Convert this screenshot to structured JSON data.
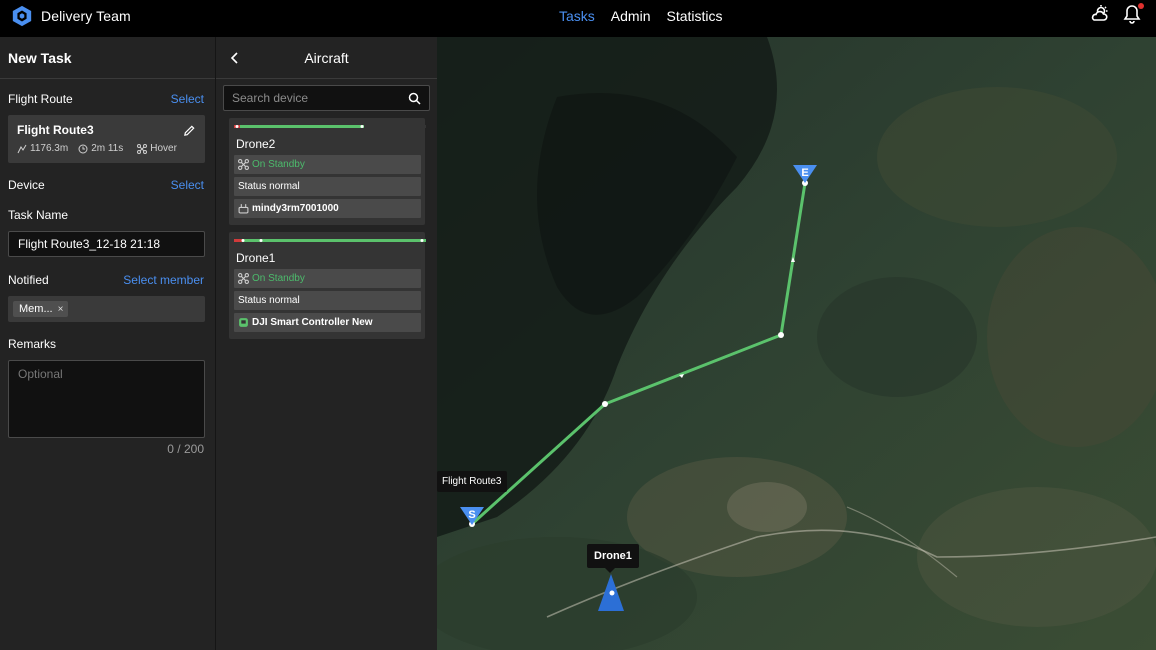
{
  "app": {
    "title": "Delivery Team"
  },
  "nav": {
    "tasks": "Tasks",
    "admin": "Admin",
    "statistics": "Statistics"
  },
  "colors": {
    "accent": "#4a8ff0",
    "standby": "#4cbb6c",
    "route": "#5bc26c"
  },
  "icons": {
    "weather": "weather-icon",
    "notification": "bell-icon"
  },
  "left": {
    "title": "New Task",
    "flight_route_label": "Flight Route",
    "select_label": "Select",
    "route": {
      "name": "Flight Route3",
      "distance": "1176.3m",
      "duration": "2m 11s",
      "mode": "Hover"
    },
    "device_label": "Device",
    "task_name_label": "Task Name",
    "task_name_value": "Flight Route3_12-18 21:18",
    "notified_label": "Notified",
    "select_member_label": "Select member",
    "member_tag": "Mem...",
    "member_tag_close": "×",
    "remarks_label": "Remarks",
    "remarks_placeholder": "Optional",
    "remarks_counter": "0 / 200"
  },
  "aircraft": {
    "title": "Aircraft",
    "search_placeholder": "Search device",
    "devices": [
      {
        "name": "Drone2",
        "status": "On Standby",
        "health": "Status normal",
        "controller": "mindy3rm7001000"
      },
      {
        "name": "Drone1",
        "status": "On Standby",
        "health": "Status normal",
        "controller": "DJI Smart Controller New"
      }
    ]
  },
  "map": {
    "route_label": "Flight Route3",
    "drone_label": "Drone1",
    "start_marker": "S",
    "end_marker": "E"
  }
}
